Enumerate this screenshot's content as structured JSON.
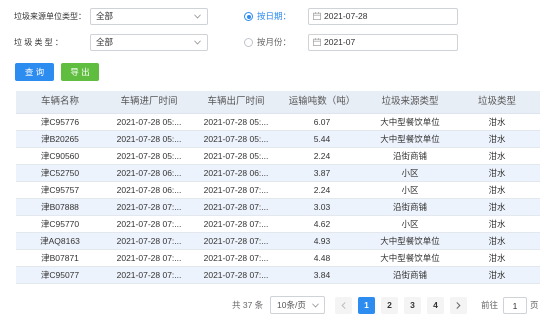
{
  "filters": {
    "source_type": {
      "label": "垃圾来源单位类型：",
      "value": "全部"
    },
    "garbage_type": {
      "label": "垃 圾 类 型 ：",
      "value": "全部"
    },
    "by_date": {
      "label": "按日期：",
      "value": "2021-07-28",
      "selected": true
    },
    "by_month": {
      "label": "按月份：",
      "value": "2021-07",
      "selected": false
    }
  },
  "buttons": {
    "query_label": "查 询",
    "export_label": "导 出"
  },
  "table": {
    "columns": [
      "车辆名称",
      "车辆进厂时间",
      "车辆出厂时间",
      "运输吨数（吨）",
      "垃圾来源类型",
      "垃圾类型"
    ],
    "rows": [
      [
        "津C95776",
        "2021-07-28 05:...",
        "2021-07-28 05:...",
        "6.07",
        "大中型餐饮单位",
        "泔水"
      ],
      [
        "津B20265",
        "2021-07-28 05:...",
        "2021-07-28 05:...",
        "5.44",
        "大中型餐饮单位",
        "泔水"
      ],
      [
        "津C90560",
        "2021-07-28 05:...",
        "2021-07-28 05:...",
        "2.24",
        "沿街商铺",
        "泔水"
      ],
      [
        "津C52750",
        "2021-07-28 06:...",
        "2021-07-28 06:...",
        "3.87",
        "小区",
        "泔水"
      ],
      [
        "津C95757",
        "2021-07-28 06:...",
        "2021-07-28 07:...",
        "2.24",
        "小区",
        "泔水"
      ],
      [
        "津B07888",
        "2021-07-28 07:...",
        "2021-07-28 07:...",
        "3.03",
        "沿街商铺",
        "泔水"
      ],
      [
        "津C95770",
        "2021-07-28 07:...",
        "2021-07-28 07:...",
        "4.62",
        "小区",
        "泔水"
      ],
      [
        "津AQ8163",
        "2021-07-28 07:...",
        "2021-07-28 07:...",
        "4.93",
        "大中型餐饮单位",
        "泔水"
      ],
      [
        "津B07871",
        "2021-07-28 07:...",
        "2021-07-28 07:...",
        "4.48",
        "大中型餐饮单位",
        "泔水"
      ],
      [
        "津C95077",
        "2021-07-28 07:...",
        "2021-07-28 07:...",
        "3.84",
        "沿街商铺",
        "泔水"
      ]
    ]
  },
  "pagination": {
    "total": "共 37 条",
    "page_size": "10条/页",
    "pages": [
      "1",
      "2",
      "3",
      "4"
    ],
    "current_page": 1,
    "goto_label": "前往",
    "goto_value": "1",
    "goto_suffix": "页"
  },
  "icons": {
    "select_arrow": "chevron-down-icon",
    "date_picker": "calendar-icon",
    "prev_page": "chevron-left-icon",
    "next_page": "chevron-right-icon",
    "radio": "radio-icon"
  },
  "colors": {
    "primary": "#2d8cf0",
    "success": "#5fbd3f",
    "table_header_bg": "#e8eef6",
    "table_stripe_bg": "#edf3fc",
    "text": "#333333"
  }
}
